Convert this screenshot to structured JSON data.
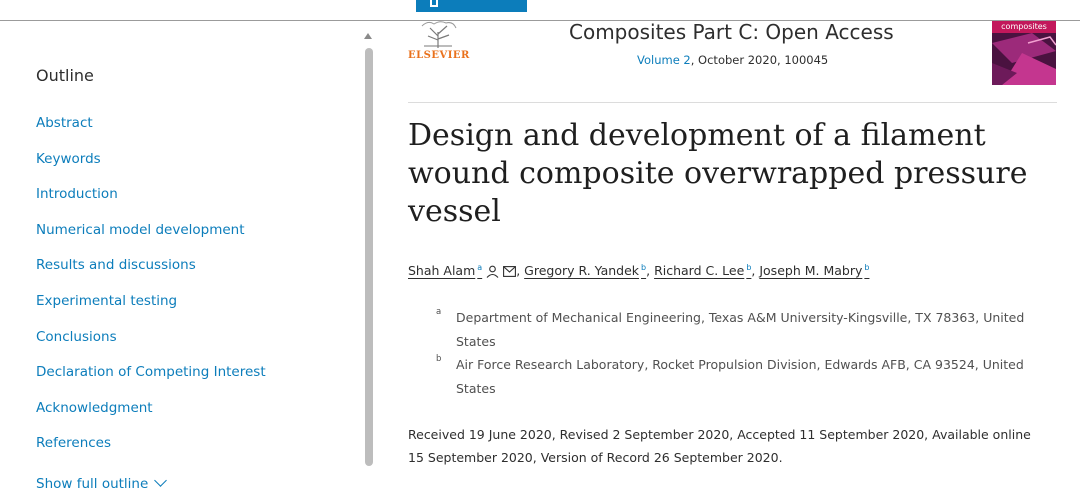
{
  "sidebar": {
    "outline_title": "Outline",
    "items": [
      {
        "label": "Abstract"
      },
      {
        "label": "Keywords"
      },
      {
        "label": "Introduction"
      },
      {
        "label": "Numerical model development"
      },
      {
        "label": "Results and discussions"
      },
      {
        "label": "Experimental testing"
      },
      {
        "label": "Conclusions"
      },
      {
        "label": "Declaration of Competing Interest"
      },
      {
        "label": "Acknowledgment"
      },
      {
        "label": "References"
      }
    ],
    "show_full_outline": "Show full outline"
  },
  "header": {
    "publisher": "ELSEVIER",
    "journal_title": "Composites Part C: Open Access",
    "volume_link": "Volume 2",
    "issue_info": ", October 2020, 100045",
    "cover_label": "composites"
  },
  "article": {
    "title": "Design and development of a filament wound composite overwrapped pressure vessel",
    "authors": [
      {
        "name": "Shah Alam",
        "sup": "a"
      },
      {
        "name": "Gregory R. Yandek",
        "sup": "b"
      },
      {
        "name": "Richard C. Lee",
        "sup": "b"
      },
      {
        "name": "Joseph M. Mabry",
        "sup": "b"
      }
    ],
    "affiliations": [
      {
        "sup": "a",
        "text": "Department of Mechanical Engineering, Texas A&M University-Kingsville, TX 78363, United States"
      },
      {
        "sup": "b",
        "text": "Air Force Research Laboratory, Rocket Propulsion Division, Edwards AFB, CA 93524, United States"
      }
    ],
    "dates": "Received 19 June 2020, Revised 2 September 2020, Accepted 11 September 2020, Available online 15 September 2020, Version of Record 26 September 2020."
  },
  "icons": {
    "person": "person-icon",
    "email": "email-icon",
    "chevron": "chevron-down-icon"
  },
  "colors": {
    "link": "#0c7dbb",
    "publisher_orange": "#e9711c"
  }
}
